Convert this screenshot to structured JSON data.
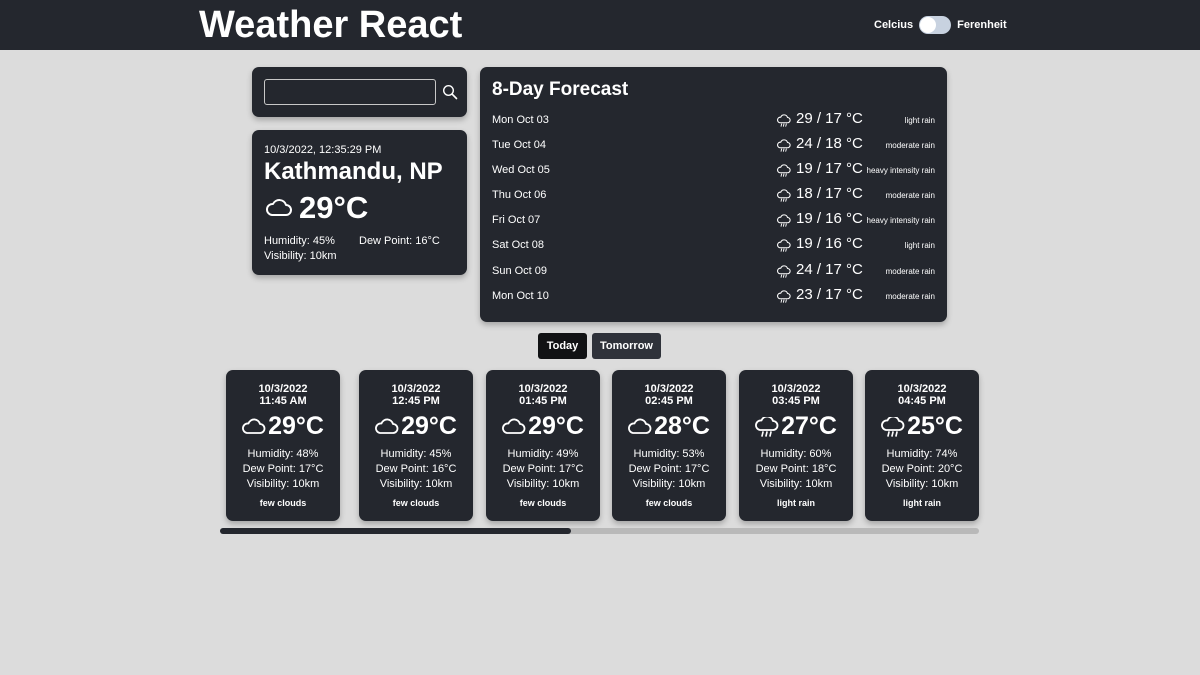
{
  "header": {
    "title": "Weather React",
    "unit_left": "Celcius",
    "unit_right": "Ferenheit"
  },
  "search": {
    "value": "",
    "placeholder": ""
  },
  "current": {
    "datetime": "10/3/2022, 12:35:29 PM",
    "city": "Kathmandu, NP",
    "temp": "29°C",
    "icon": "cloud-icon",
    "humidity": "Humidity: 45%",
    "dew_point": "Dew Point: 16°C",
    "visibility": "Visibility: 10km"
  },
  "forecast": {
    "title": "8-Day Forecast",
    "days": [
      {
        "day": "Mon Oct 03",
        "temp": "29 / 17 °C",
        "desc": "light rain",
        "icon": "rain-cloud-icon"
      },
      {
        "day": "Tue Oct 04",
        "temp": "24 / 18 °C",
        "desc": "moderate rain",
        "icon": "rain-cloud-icon"
      },
      {
        "day": "Wed Oct 05",
        "temp": "19 / 17 °C",
        "desc": "heavy intensity rain",
        "icon": "rain-cloud-icon"
      },
      {
        "day": "Thu Oct 06",
        "temp": "18 / 17 °C",
        "desc": "moderate rain",
        "icon": "rain-cloud-icon"
      },
      {
        "day": "Fri Oct 07",
        "temp": "19 / 16 °C",
        "desc": "heavy intensity rain",
        "icon": "rain-cloud-icon"
      },
      {
        "day": "Sat Oct 08",
        "temp": "19 / 16 °C",
        "desc": "light rain",
        "icon": "rain-cloud-icon"
      },
      {
        "day": "Sun Oct 09",
        "temp": "24 / 17 °C",
        "desc": "moderate rain",
        "icon": "rain-cloud-icon"
      },
      {
        "day": "Mon Oct 10",
        "temp": "23 / 17 °C",
        "desc": "moderate rain",
        "icon": "rain-cloud-icon"
      }
    ]
  },
  "tabs": {
    "today": "Today",
    "tomorrow": "Tomorrow",
    "active": "Today"
  },
  "hourly": [
    {
      "date": "10/3/2022",
      "time": "11:45 AM",
      "temp": "29°C",
      "humidity": "Humidity: 48%",
      "dew_point": "Dew Point: 17°C",
      "visibility": "Visibility: 10km",
      "desc": "few clouds",
      "icon": "cloud-icon"
    },
    {
      "date": "10/3/2022",
      "time": "12:45 PM",
      "temp": "29°C",
      "humidity": "Humidity: 45%",
      "dew_point": "Dew Point: 16°C",
      "visibility": "Visibility: 10km",
      "desc": "few clouds",
      "icon": "cloud-icon"
    },
    {
      "date": "10/3/2022",
      "time": "01:45 PM",
      "temp": "29°C",
      "humidity": "Humidity: 49%",
      "dew_point": "Dew Point: 17°C",
      "visibility": "Visibility: 10km",
      "desc": "few clouds",
      "icon": "cloud-icon"
    },
    {
      "date": "10/3/2022",
      "time": "02:45 PM",
      "temp": "28°C",
      "humidity": "Humidity: 53%",
      "dew_point": "Dew Point: 17°C",
      "visibility": "Visibility: 10km",
      "desc": "few clouds",
      "icon": "cloud-icon"
    },
    {
      "date": "10/3/2022",
      "time": "03:45 PM",
      "temp": "27°C",
      "humidity": "Humidity: 60%",
      "dew_point": "Dew Point: 18°C",
      "visibility": "Visibility: 10km",
      "desc": "light rain",
      "icon": "rain-cloud-icon"
    },
    {
      "date": "10/3/2022",
      "time": "04:45 PM",
      "temp": "25°C",
      "humidity": "Humidity: 74%",
      "dew_point": "Dew Point: 20°C",
      "visibility": "Visibility: 10km",
      "desc": "light rain",
      "icon": "rain-cloud-icon"
    }
  ],
  "colors": {
    "panel": "#24272e",
    "background": "#dcdcdc",
    "toggle": "#c8d2e0"
  }
}
